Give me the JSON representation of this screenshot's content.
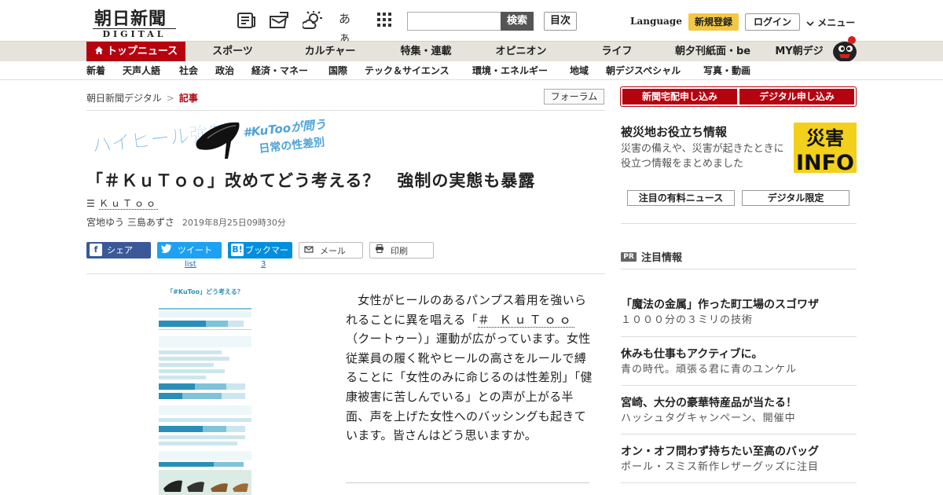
{
  "header": {
    "logo_main": "朝日新聞",
    "logo_sub": "DIGITAL",
    "search_placeholder": "",
    "search_button": "検索",
    "toc_button": "目次",
    "language": "Language",
    "register": "新規登録",
    "login": "ログイン",
    "menu": "メニュー",
    "font_size_icon_text": "あぁ"
  },
  "nav_primary": [
    {
      "label": "トップニュース",
      "active": true
    },
    {
      "label": "スポーツ"
    },
    {
      "label": "カルチャー"
    },
    {
      "label": "特集・連載"
    },
    {
      "label": "オピニオン"
    },
    {
      "label": "ライフ"
    },
    {
      "label": "朝夕刊紙面・be"
    },
    {
      "label": "MY朝デジ"
    }
  ],
  "nav_secondary": [
    "新着",
    "天声人語",
    "社会",
    "政治",
    "経済・マネー",
    "国際",
    "テック＆サイエンス",
    "環境・エネルギー",
    "地域",
    "朝デジスペシャル",
    "写真・動画"
  ],
  "breadcrumb": {
    "home": "朝日新聞デジタル",
    "sep": ">",
    "current": "記事"
  },
  "forum_button": "フォーラム",
  "banner": {
    "title": "ハイヒール強制",
    "sub1": "#KuTooが問う",
    "sub2": "日常の性差別"
  },
  "article": {
    "title": "「＃ＫｕＴｏｏ」改めてどう考える？　強制の実態も暴露",
    "topic": "ＫｕＴｏｏ",
    "authors": "宮地ゆう 三島あずさ",
    "date": "2019年8月25日09時30分",
    "body_pre": "　女性がヒールのあるパンプス着用を強いられることに異を唱える「",
    "body_kw": "＃ ＫｕＴｏｏ",
    "body_post": "（クートゥー）」運動が広がっています。女性従業員の履く靴やヒールの高さをルールで縛ることに「女性のみに命じるのは性差別」「健康被害に苦しんでいる」との声が上がる半面、声を上げた女性へのバッシングも起きています。皆さんはどう思いますか。"
  },
  "share": {
    "facebook": {
      "label": "シェア"
    },
    "twitter": {
      "label": "ツイート",
      "count": "list"
    },
    "hatena": {
      "label": "ブックマーク",
      "count": "3"
    },
    "mail": {
      "label": "メール"
    },
    "print": {
      "label": "印刷"
    }
  },
  "infographic": {
    "title": "「#KuToo」どう考える？",
    "q1": "接客業において女性従業員が履く靴の種類やヒールの高さを、社内のルールとして定めることをどう思いますか？",
    "q2": "それについてあなたの考えに最も近いものを1つ選んで下さい",
    "q3": "働く人の服装や靴の取り決めについて、男女で差がある職場はあることを、どう思いますか？",
    "q4": "あなたは仕事中に履く靴を選ぶとき、何をいちばん重視しますか？"
  },
  "sidebar": {
    "subscribe_paper": "新聞宅配申し込み",
    "subscribe_digital": "デジタル申し込み",
    "disaster_title": "被災地お役立ち情報",
    "disaster_desc": "災害の備えや、災害が起きたときに役立つ情報をまとめました",
    "disaster_badge_top": "災害",
    "disaster_badge_bottom": "INFO",
    "paid_news": "注目の有料ニュース",
    "digital_only": "デジタル限定",
    "pr_badge": "PR",
    "pr_title": "注目情報",
    "pr_items": [
      {
        "title": "「魔法の金属」作った町工場のスゴワザ",
        "desc": "１０００分の３ミリの技術"
      },
      {
        "title": "休みも仕事もアクティブに。",
        "desc": "青の時代。頑張る君に青のユンケル"
      },
      {
        "title": "宮崎、大分の豪華特産品が当たる！",
        "desc": "ハッシュタグキャンペーン、開催中"
      },
      {
        "title": "オン・オフ問わず持ちたい至高のバッグ",
        "desc": "ポール・スミス新作レザーグッズに注目"
      }
    ]
  },
  "colors": {
    "brand_red": "#b5030f",
    "facebook": "#3b5998",
    "twitter": "#1da1f2",
    "hatena": "#008fde",
    "register": "#f3c744",
    "banner_blue": "#4da3d9"
  }
}
